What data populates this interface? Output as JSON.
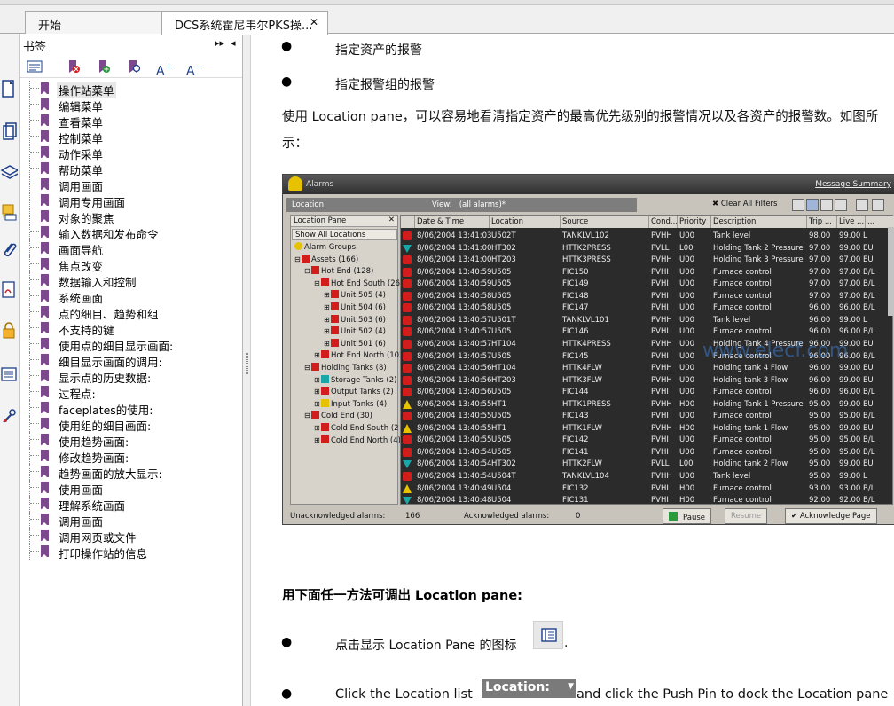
{
  "tabs": [
    {
      "label": "开始"
    },
    {
      "label": "DCS系统霍尼韦尔PKS操...",
      "close": "✕"
    }
  ],
  "bookmarks_panel": {
    "title": "书签",
    "expand_icon": "▸▸",
    "collapse_icon": "◂",
    "items": [
      "操作站菜单",
      "编辑菜单",
      "查看菜单",
      "控制菜单",
      "动作采单",
      "帮助菜单",
      "调用画面",
      "调用专用画面",
      "对象的聚焦",
      "输入数据和发布命令",
      "画面导航",
      "焦点改变",
      "数据输入和控制",
      "系统画面",
      "点的细目、趋势和组",
      "不支持的键",
      "使用点的细目显示画面:",
      "细目显示画面的调用:",
      "显示点的历史数据:",
      "过程点:",
      "faceplates的使用:",
      "使用组的细目画面:",
      "使用趋势画面:",
      "修改趋势画面:",
      "趋势画面的放大显示:",
      "使用画面",
      "理解系统画面",
      "调用画面",
      "调用网页或文件",
      "打印操作站的信息"
    ]
  },
  "document": {
    "bullet1": "指定资产的报警",
    "bullet2": "指定报警组的报警",
    "para1": "使用 Location pane，可以容易地看清指定资产的最高优先级别的报警情况以及各资产的报警数。如图所示：",
    "heading": "用下面任一方法可调出 Location pane:",
    "bullet3_pre": "点击显示 Location Pane 的图标",
    "bullet3_post": ".",
    "bullet4_pre": "Click the Location list",
    "loc_button": "Location:",
    "bullet4_post": "and click the Push Pin to dock the Location pane"
  },
  "alarm_shot": {
    "title": "Alarms",
    "message_summary": "Message Summary",
    "location_label": "Location:",
    "view_label": "View:",
    "view_value": "(all alarms)*",
    "clear_filters": "Clear All Filters",
    "location_pane": "Location Pane",
    "show_all": "Show All Locations",
    "tree": [
      {
        "label": "Alarm Groups",
        "indent": 0,
        "kind": "group"
      },
      {
        "label": "Assets (166)",
        "indent": 0,
        "kind": "red",
        "exp": "⊟"
      },
      {
        "label": "Hot End (128)",
        "indent": 1,
        "kind": "red",
        "exp": "⊟"
      },
      {
        "label": "Hot End South (26",
        "indent": 2,
        "kind": "red",
        "exp": "⊟"
      },
      {
        "label": "Unit 505 (4)",
        "indent": 3,
        "kind": "red",
        "exp": "⊞"
      },
      {
        "label": "Unit 504 (6)",
        "indent": 3,
        "kind": "red",
        "exp": "⊞"
      },
      {
        "label": "Unit 503 (6)",
        "indent": 3,
        "kind": "red",
        "exp": "⊞"
      },
      {
        "label": "Unit 502 (4)",
        "indent": 3,
        "kind": "red",
        "exp": "⊞"
      },
      {
        "label": "Unit 501 (6)",
        "indent": 3,
        "kind": "red",
        "exp": "⊞"
      },
      {
        "label": "Hot End North (102",
        "indent": 2,
        "kind": "red",
        "exp": "⊞"
      },
      {
        "label": "Holding Tanks (8)",
        "indent": 1,
        "kind": "red",
        "exp": "⊟"
      },
      {
        "label": "Storage Tanks (2)",
        "indent": 2,
        "kind": "cyan",
        "exp": "⊞"
      },
      {
        "label": "Output Tanks (2)",
        "indent": 2,
        "kind": "red",
        "exp": "⊞"
      },
      {
        "label": "Input Tanks (4)",
        "indent": 2,
        "kind": "yellow",
        "exp": "⊞"
      },
      {
        "label": "Cold End (30)",
        "indent": 1,
        "kind": "red",
        "exp": "⊟"
      },
      {
        "label": "Cold End South (2",
        "indent": 2,
        "kind": "red",
        "exp": "⊞"
      },
      {
        "label": "Cold End North (4)",
        "indent": 2,
        "kind": "red",
        "exp": "⊞"
      }
    ],
    "columns": [
      "Date & Time",
      "Location",
      "Source",
      "Cond...",
      "Priority",
      "Description",
      "Trip ...",
      "Live ...",
      "..."
    ],
    "rows": [
      [
        "8/06/2004 13:41:03",
        "U502T",
        "TANKLVL102",
        "PVHH",
        "U00",
        "Tank level",
        "98.00",
        "99.00 L",
        "red"
      ],
      [
        "8/06/2004 13:41:00",
        "HT302",
        "HTTK2PRESS",
        "PVLL",
        "L00",
        "Holding Tank 2 Pressure",
        "97.00",
        "99.00 EU",
        "cyan"
      ],
      [
        "8/06/2004 13:41:00",
        "HT203",
        "HTTK3PRESS",
        "PVHH",
        "U00",
        "Holding Tank 3 Pressure",
        "97.00",
        "97.00 EU",
        "red"
      ],
      [
        "8/06/2004 13:40:59",
        "U505",
        "FIC150",
        "PVHI",
        "U00",
        "Furnace control",
        "97.00",
        "97.00 B/L",
        "red"
      ],
      [
        "8/06/2004 13:40:59",
        "U505",
        "FIC149",
        "PVHI",
        "U00",
        "Furnace control",
        "97.00",
        "97.00 B/L",
        "red"
      ],
      [
        "8/06/2004 13:40:58",
        "U505",
        "FIC148",
        "PVHI",
        "U00",
        "Furnace control",
        "97.00",
        "97.00 B/L",
        "red"
      ],
      [
        "8/06/2004 13:40:58",
        "U505",
        "FIC147",
        "PVHI",
        "U00",
        "Furnace control",
        "96.00",
        "96.00 B/L",
        "red"
      ],
      [
        "8/06/2004 13:40:57",
        "U501T",
        "TANKLVL101",
        "PVHH",
        "U00",
        "Tank level",
        "96.00",
        "99.00 L",
        "red"
      ],
      [
        "8/06/2004 13:40:57",
        "U505",
        "FIC146",
        "PVHI",
        "U00",
        "Furnace control",
        "96.00",
        "96.00 B/L",
        "red"
      ],
      [
        "8/06/2004 13:40:57",
        "HT104",
        "HTTK4PRESS",
        "PVHH",
        "U00",
        "Holding Tank 4 Pressure",
        "96.00",
        "99.00 EU",
        "red"
      ],
      [
        "8/06/2004 13:40:57",
        "U505",
        "FIC145",
        "PVHI",
        "U00",
        "Furnace control",
        "96.00",
        "96.00 B/L",
        "red"
      ],
      [
        "8/06/2004 13:40:56",
        "HT104",
        "HTTK4FLW",
        "PVHH",
        "U00",
        "Holding tank 4 Flow",
        "96.00",
        "99.00 EU",
        "red"
      ],
      [
        "8/06/2004 13:40:56",
        "HT203",
        "HTTK3FLW",
        "PVHH",
        "U00",
        "Holding tank 3 Flow",
        "96.00",
        "99.00 EU",
        "red"
      ],
      [
        "8/06/2004 13:40:56",
        "U505",
        "FIC144",
        "PVHI",
        "U00",
        "Furnace control",
        "96.00",
        "96.00 B/L",
        "red"
      ],
      [
        "8/06/2004 13:40:55",
        "HT1",
        "HTTK1PRESS",
        "PVHH",
        "H00",
        "Holding Tank 1 Pressure",
        "95.00",
        "99.00 EU",
        "yellow"
      ],
      [
        "8/06/2004 13:40:55",
        "U505",
        "FIC143",
        "PVHI",
        "U00",
        "Furnace control",
        "95.00",
        "95.00 B/L",
        "red"
      ],
      [
        "8/06/2004 13:40:55",
        "HT1",
        "HTTK1FLW",
        "PVHH",
        "H00",
        "Holding tank 1 Flow",
        "95.00",
        "99.00 EU",
        "yellow"
      ],
      [
        "8/06/2004 13:40:55",
        "U505",
        "FIC142",
        "PVHI",
        "U00",
        "Furnace control",
        "95.00",
        "95.00 B/L",
        "red"
      ],
      [
        "8/06/2004 13:40:54",
        "U505",
        "FIC141",
        "PVHI",
        "U00",
        "Furnace control",
        "95.00",
        "95.00 B/L",
        "red"
      ],
      [
        "8/06/2004 13:40:54",
        "HT302",
        "HTTK2FLW",
        "PVLL",
        "L00",
        "Holding tank 2 Flow",
        "95.00",
        "99.00 EU",
        "cyan"
      ],
      [
        "8/06/2004 13:40:54",
        "U504T",
        "TANKLVL104",
        "PVHH",
        "U00",
        "Tank level",
        "95.00",
        "99.00 L",
        "red"
      ],
      [
        "8/06/2004 13:40:49",
        "U504",
        "FIC132",
        "PVHI",
        "H00",
        "Furnace control",
        "93.00",
        "93.00 B/L",
        "yellow"
      ],
      [
        "8/06/2004 13:40:48",
        "U504",
        "FIC131",
        "PVHI",
        "H00",
        "Furnace control",
        "92.00",
        "92.00 B/L",
        "cyan"
      ]
    ],
    "unack_label": "Unacknowledged alarms:",
    "unack_count": "166",
    "ack_label": "Acknowledged alarms:",
    "ack_count": "0",
    "pause_label": "Pause",
    "resume_label": "Resume",
    "ack_page_label": "Acknowledge Page",
    "watermark": "www.elecf.com"
  },
  "colors": {
    "bookmark_flag": "#7c4a8c",
    "alarm_red": "#d21d1d",
    "alarm_cyan": "#19a7a7",
    "alarm_yellow": "#e7c200",
    "grid_bg": "#2b2b2b"
  }
}
